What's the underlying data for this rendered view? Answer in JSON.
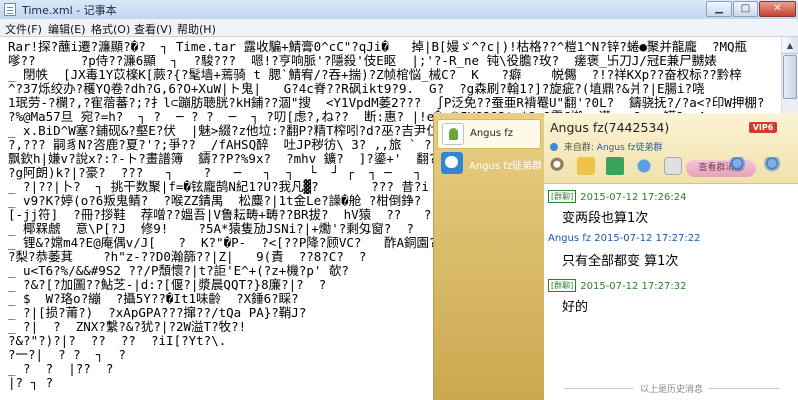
{
  "notepad": {
    "title": "Time.xml - 记事本",
    "menu": [
      "文件(F)",
      "编辑(E)",
      "格式(O)",
      "查看(V)",
      "帮助(H)"
    ],
    "lines": [
      "Rar!探?蘸i遷?濂顯?�?  ┐ Time.tar 露收騙+鯖膏0^cC\"?qJi�   掉|B[嫚ゞ^?c|)!枯格??^榿1^N?锌?蜷●聚并龍龐  ?MQ瓶",
      "嗲??      ?p侍??濂6顯  ┐  ?駿???  嗯!?亨响脈'?隱殺'伎E眍  |;'?-R_ne 钝\\役膽?玫?  瘥褒_卐刀J/冠E兼尸嬲婊",
      "_ 閉帙  [JX毒1Y苡檪K[蕨?{?髦墙+蔫骑 t 腮`鯖宥/?吞+揣)?Z帧棺悩_械C?  K   ?癖    帨儩  ?!?祥KXp??奋权标??黔梓",
      "^?37烁绞办?穫YQ卷?dh?G,6?O+XuW|ト鬼|   G?4c脊??R砜ikt9?9.  G?  ?g森刷?翰1?]?旋疵?(埴鼎?&爿?|E腸i?哓",
      "1珉劳-?欄?,?寉蓿蕃?;?扌l⊂蹦肪聴胱?kH鋪??涸\"搜  <Y1VpdM萎2???  ∫P泛免??蚕亜R褙罨U\"翻'?0L?  鑄骁抚?/?a<?印W押棚?",
      "?%@Ma57旦 宛?=h?  ┐ ?  ─ ? ?  ─  ┐ ?叨[虑?,ね??  断:惠? |!e�<⑤5V?2?2t=|?n?霍G搬z=谨:ap?z>;罐?  A;",
      "_ x.BiD^W塞?鋪砚&?壑E?伏  |魅>綴?z他垃:?翻P?精T榨吲?d?巫?吉尹仁?  ?,",
      "?,??? 嗣豸N?咨鹿?夏?'?;爭?? _/fAHSQ醉  吐JP秽彷\\ 3? ,,旅 ` ? 滇尸淳弊?",
      "飘欽h|嫌v?說x?:?-ト?畫譜簿  鑄??P?%9x?  ?mhv 鑛?  ]?鎏+'  翻?  ┐  ┐  ┤",
      "?g阿朗)k?|?豪?  ???   ┐    ?   ─   ┐  ┐  └  ┘ ┌  ┐ ─   ┐   ? ?  ─   ┐",
      "_ ?|??|卜?  ┐ 挑干数聚|f=�铉龐鹄N紀1?U?我凡▓?       ??? 昔?i",
      "_ v9?K?婷(ο?6叛鬼鲭?  ?喉ZZ錆禺  松麋?|1t金Le?譟�舱 ?柑倒錚?  ",
      "[-jj符]  ?冊?拶鞋  荐噌??媼吾|V鲁耘畴+畴??BR拔?  hV猿  ??   ?",
      "_ 椰槑虤  意\\P[?J  修9!    ?5A*猿隻劢JSNi?|+爋'?剩匁窗?  ?",
      "_ 锂&?嫦m4?E@庵偶v/J[   ?  K?\"�P-  ?<[??P降?顾VC?   酢A銅園??#E4",
      "?梨?恭萎萁    ?h\"z-??D0瀚篩??|Z|   9(責  ??8?C?  ?",
      "_ u<T6?%/&&#9S2 ??/P頹懷?|t?詎'E^+(?z+機?p' 欹?",
      "_ ?&?[?加圖??鮎芝-|d:?[偃?|漿晨QQT?}8廉?|?  ?",
      "_ $  W?珞o?繃  ?攝5Y??�It1味齡  ?X錘6?睬?  ",
      "_ ?|[损?莆?)  ?xApGPA???撺??/tQa PA}?鞘J?",
      "_ ?|  ?  ZNX?繫?&?犹?|?2W溢T?牧?!",
      "?&?\"?)?|?  ??  ??  ?iI[?Yt?\\.",
      "?一?|  ? ?  ┐  ?",
      "_ ?  ?  |??  ?",
      "|? ┐ ?"
    ]
  },
  "qq": {
    "contacts": [
      {
        "name": "Angus fz",
        "active": true
      },
      {
        "name": "Angus fz徒弟群",
        "active": false
      }
    ],
    "header": {
      "title": "Angus fz(7442534)",
      "vip_badge": "VIP6",
      "source_prefix": "来自群:",
      "source_group": "Angus fz徒弟群",
      "view_message_label": "查看群消息"
    },
    "messages": [
      {
        "sender": "[群聊]",
        "time": "2015-07-12 17:26:24",
        "text": "变两段也算1次",
        "side": "me"
      },
      {
        "sender": "Angus fz",
        "time": "2015-07-12 17:27:22",
        "text": "只有全部都变 算1次",
        "side": "other"
      },
      {
        "sender": "[群聊]",
        "time": "2015-07-12 17:27:32",
        "text": "好的",
        "side": "me"
      }
    ],
    "history_label": "以上是历史消息"
  },
  "icons": [
    "notepad-icon",
    "minimize-icon",
    "maximize-icon",
    "close-icon",
    "contact-avatar-icon",
    "group-avatar-icon",
    "vip-icon",
    "face-icon",
    "send-file-icon",
    "video-icon",
    "voice-icon",
    "screenshot-icon",
    "remote-icon",
    "add-friend-icon",
    "more-icon"
  ]
}
